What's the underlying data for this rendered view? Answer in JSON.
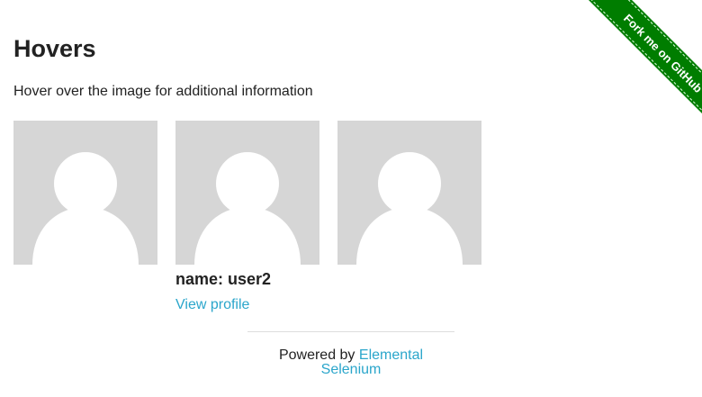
{
  "page": {
    "title": "Hovers",
    "intro": "Hover over the image for additional information"
  },
  "figures": [
    {
      "caption": {
        "name": "",
        "link": ""
      }
    },
    {
      "caption": {
        "name": "name: user2",
        "link": "View profile"
      }
    },
    {
      "caption": {
        "name": "",
        "link": ""
      }
    }
  ],
  "footer": {
    "prefix": "Powered by",
    "link": "Elemental Selenium"
  },
  "ribbon": {
    "label": "Fork me on GitHub"
  },
  "colors": {
    "link": "#2ba6cb",
    "ribbon": "#007d00",
    "avatar_bg": "#d6d6d6",
    "avatar_fg": "#ffffff"
  },
  "icons": {
    "avatar": "user-avatar-icon"
  }
}
